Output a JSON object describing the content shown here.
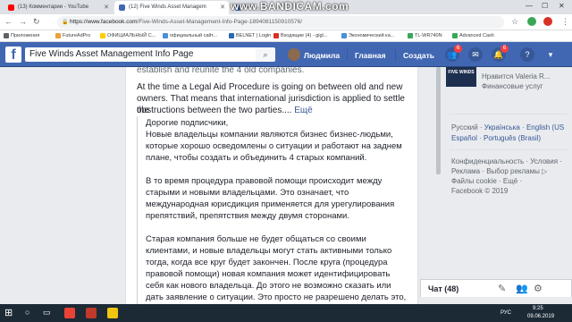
{
  "browser": {
    "tabs": [
      {
        "label": "(13) Комментарии - YouTube",
        "active": false,
        "favicon_color": "#ff0000"
      },
      {
        "label": "(12) Five Winds Asset Managem",
        "active": true,
        "favicon_color": "#4267b2"
      },
      {
        "label": "Кан",
        "active": false,
        "favicon_color": "#4267b2"
      }
    ],
    "url_host": "https://www.facebook.com",
    "url_path": "/Five-Winds-Asset-Management-Info-Page-1894081150910576/",
    "bookmarks": [
      {
        "label": "Приложения",
        "color": "#5f6368"
      },
      {
        "label": "FutureAdPro",
        "color": "#e8a33d"
      },
      {
        "label": "ОФИЦИАЛЬНЫЙ С...",
        "color": "#ffcc00"
      },
      {
        "label": "официальный сайт...",
        "color": "#4a90d9"
      },
      {
        "label": "BELNET | Login",
        "color": "#2a6ab5"
      },
      {
        "label": "Входящие (4) - gigl...",
        "color": "#d93025"
      },
      {
        "label": "Экономический ка...",
        "color": "#4a90d9"
      },
      {
        "label": "TL-WR740N",
        "color": "#3aa757"
      },
      {
        "label": "Advanced Cash",
        "color": "#3aa757"
      }
    ]
  },
  "watermark": "www.BANDICAM.com",
  "facebook": {
    "logo": "f",
    "search_value": "Five Winds Asset Management Info Page",
    "user_name": "Людмила",
    "nav_home": "Главная",
    "nav_create": "Создать",
    "friend_badge": "6",
    "notif_badge": "6",
    "post": {
      "line_top": "establish and reunite the 4 old companies.",
      "english": [
        "At the time a Legal Aid Procedure is going on between old and new",
        "owners. That means that international jurisdiction is applied to settle the",
        "obstructions between the two parties.... "
      ],
      "more_link": "Ещё",
      "russian": [
        "Дорогие подписчики,",
        "Новые владельцы компании являются бизнес бизнес-людьми,",
        "которые хорошо осведомлены о ситуации и работают на заднем",
        "плане, чтобы создать и объединить 4 старых компаний.",
        "",
        "В то время процедура правовой помощи происходит между",
        "старыми и новыми владельцами. Это означает, что",
        "международная юрисдикция применяется для урегулирования",
        "препятствий, препятствия между двумя сторонами.",
        "",
        "Старая компания больше не будет общаться со своими",
        "клиентами, и новые владельцы могут стать активными только",
        "тогда, когда все круг будет закончен. После круга (процедура",
        "правовой помощи) новая компания может идентифицировать",
        "себя как нового владельца. До этого не возможно сказать или",
        "дать заявление о ситуации. Это просто не разрешено делать это,"
      ]
    },
    "right": {
      "page_thumb": "FIVE WINDS",
      "liked_by": "Нравится Valeria R...",
      "category": "Финансовые услуг",
      "languages_line1_a": "Русский",
      "languages_line1_b": "Українська",
      "languages_line1_c": "English (US",
      "languages_line2_a": "Español",
      "languages_line2_b": "Português (Brasil)",
      "footer1": "Конфиденциальность · Условия ·",
      "footer2": "Реклама · Выбор рекламы ▷",
      "footer3": "Файлы cookie · Ещё ·",
      "footer4": "Facebook © 2019"
    },
    "chat_label": "Чат (48)"
  },
  "taskbar": {
    "time": "9:25",
    "date": "09.06.2019",
    "lang": "РУС"
  }
}
